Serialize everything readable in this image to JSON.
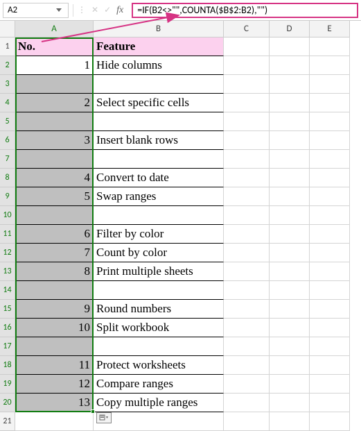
{
  "name_box": {
    "value": "A2"
  },
  "formula_bar": {
    "fx_label": "fx",
    "formula": "=IF(B2<>\"\",COUNTA($B$2:B2),\"\")"
  },
  "columns": [
    {
      "letter": "A",
      "class": "col-A",
      "hl": true
    },
    {
      "letter": "B",
      "class": "col-B",
      "hl": false
    },
    {
      "letter": "C",
      "class": "col-C",
      "hl": false
    },
    {
      "letter": "D",
      "class": "col-D",
      "hl": false
    },
    {
      "letter": "E",
      "class": "col-E",
      "hl": false
    }
  ],
  "header_row": {
    "a": "No.",
    "b": "Feature"
  },
  "data_rows": [
    {
      "n": "2",
      "a": "1",
      "b": "Hide columns",
      "active": true
    },
    {
      "n": "3",
      "a": "",
      "b": "",
      "active": false
    },
    {
      "n": "4",
      "a": "2",
      "b": "Select specific cells",
      "active": false
    },
    {
      "n": "5",
      "a": "",
      "b": "",
      "active": false
    },
    {
      "n": "6",
      "a": "3",
      "b": "Insert blank rows",
      "active": false
    },
    {
      "n": "7",
      "a": "",
      "b": "",
      "active": false
    },
    {
      "n": "8",
      "a": "4",
      "b": "Convert to date",
      "active": false
    },
    {
      "n": "9",
      "a": "5",
      "b": "Swap ranges",
      "active": false
    },
    {
      "n": "10",
      "a": "",
      "b": "",
      "active": false
    },
    {
      "n": "11",
      "a": "6",
      "b": "Filter by color",
      "active": false
    },
    {
      "n": "12",
      "a": "7",
      "b": "Count by color",
      "active": false
    },
    {
      "n": "13",
      "a": "8",
      "b": "Print multiple sheets",
      "active": false
    },
    {
      "n": "14",
      "a": "",
      "b": "",
      "active": false
    },
    {
      "n": "15",
      "a": "9",
      "b": "Round numbers",
      "active": false
    },
    {
      "n": "16",
      "a": "10",
      "b": "Split workbook",
      "active": false
    },
    {
      "n": "17",
      "a": "",
      "b": "",
      "active": false
    },
    {
      "n": "18",
      "a": "11",
      "b": "Protect worksheets",
      "active": false
    },
    {
      "n": "19",
      "a": "12",
      "b": "Compare ranges",
      "active": false
    },
    {
      "n": "20",
      "a": "13",
      "b": "Copy multiple ranges",
      "active": false
    }
  ],
  "extra_rows": [
    {
      "n": "21"
    }
  ]
}
